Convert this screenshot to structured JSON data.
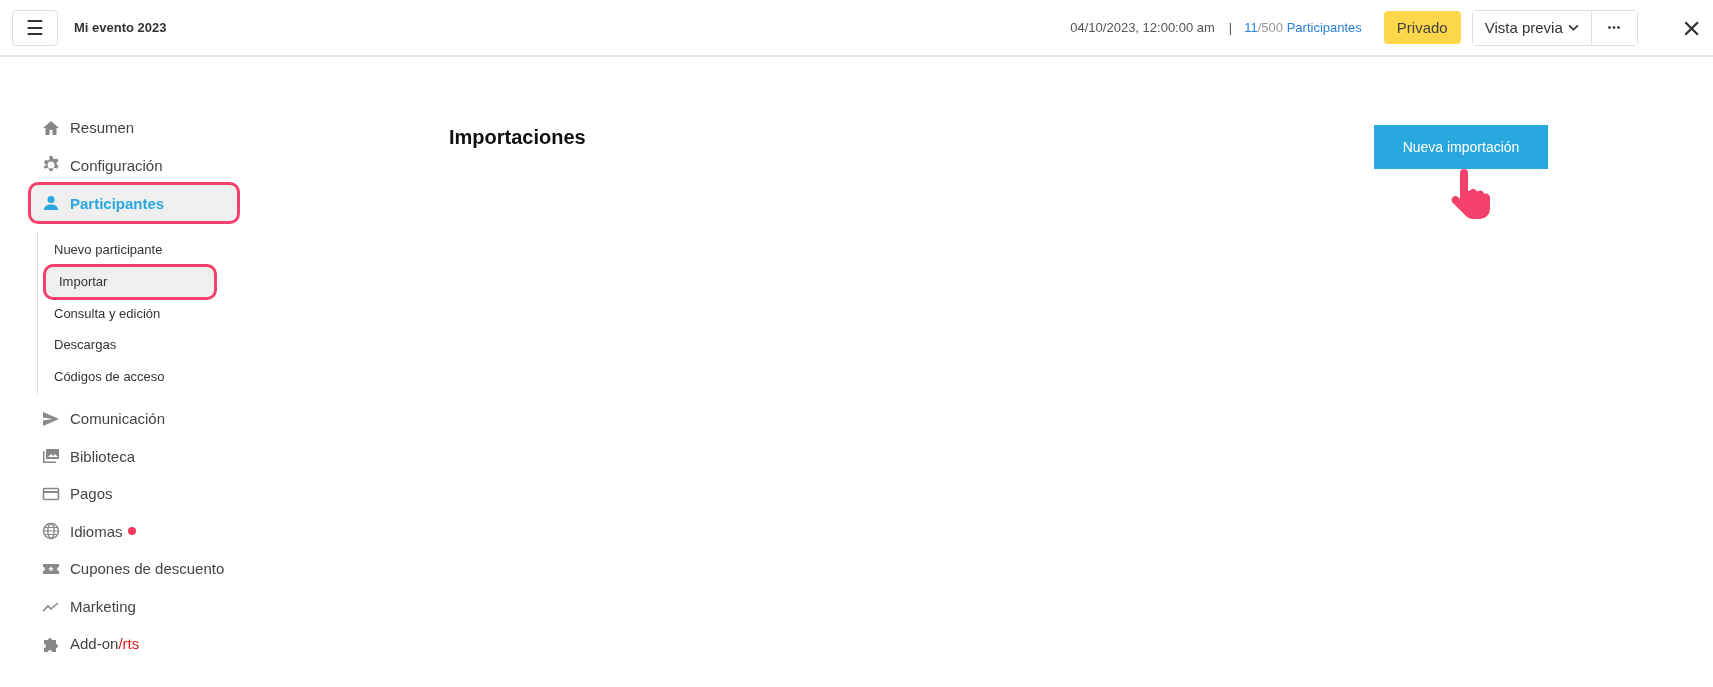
{
  "header": {
    "menu_button": "☰",
    "title": "Mi evento 2023",
    "datetime": "04/10/2023, 12:00:00 am",
    "separator": "|",
    "participants_count": "11",
    "participants_total": "/500",
    "participants_label": "Participantes",
    "status_badge": "Privado",
    "preview_button": "Vista previa",
    "more_button": "•••",
    "close": "×"
  },
  "sidebar": {
    "items": [
      {
        "kind": "home",
        "label": "Resumen",
        "selected": false,
        "highlighted": false
      },
      {
        "kind": "gear",
        "label": "Configuración",
        "selected": false,
        "highlighted": false
      },
      {
        "kind": "person",
        "label": "Participantes",
        "selected": true,
        "highlighted": true,
        "children": [
          {
            "label": "Nuevo participante",
            "selected": false,
            "highlighted": false
          },
          {
            "label": "Importar",
            "selected": true,
            "highlighted": true
          },
          {
            "label": "Consulta y edición",
            "selected": false,
            "highlighted": false
          },
          {
            "label": "Descargas",
            "selected": false,
            "highlighted": false
          },
          {
            "label": "Códigos de acceso",
            "selected": false,
            "highlighted": false
          }
        ]
      },
      {
        "kind": "send",
        "label": "Comunicación",
        "selected": false,
        "highlighted": false
      },
      {
        "kind": "images",
        "label": "Biblioteca",
        "selected": false,
        "highlighted": false
      },
      {
        "kind": "card",
        "label": "Pagos",
        "selected": false,
        "highlighted": false
      },
      {
        "kind": "globe",
        "label": "Idiomas",
        "selected": false,
        "highlighted": false,
        "color": "#f7385f"
      },
      {
        "kind": "ticket",
        "label": "Cupones de descuento",
        "selected": false,
        "highlighted": false
      },
      {
        "kind": "trend",
        "label": "Marketing",
        "selected": false,
        "highlighted": false
      },
      {
        "kind": "puzzle",
        "label": "Add-on",
        "suffix": "/rts",
        "selected": false,
        "highlighted": false
      }
    ]
  },
  "main": {
    "title": "Importaciones",
    "primary_button": "Nueva importación",
    "pointer_hint": true
  }
}
